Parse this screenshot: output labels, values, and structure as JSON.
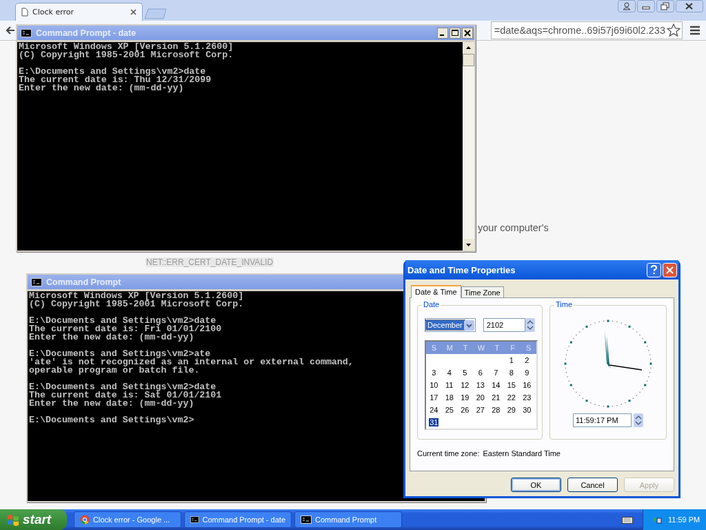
{
  "browser": {
    "tabs": [
      {
        "title": "Clock error",
        "selected": true
      }
    ],
    "address": "=date&aqs=chrome..69i57j69i60l2.233",
    "page_texts": [
      {
        "text": "your computer's",
        "kind": "body"
      },
      {
        "text": "NET::ERR_CERT_DATE_INVALID",
        "kind": "code"
      }
    ]
  },
  "console_windows": [
    {
      "title": "Command Prompt - date",
      "controls": true,
      "blocks": [
        [
          "Microsoft Windows XP [Version 5.1.2600]",
          "(C) Copyright 1985-2001 Microsoft Corp."
        ],
        [
          "E:\\Documents and Settings\\vm2>date",
          "The current date is: Thu 12/31/2099",
          "Enter the new date: (mm-dd-yy)"
        ]
      ]
    },
    {
      "title": "Command Prompt",
      "controls": false,
      "blocks": [
        [
          "Microsoft Windows XP [Version 5.1.2600]",
          "(C) Copyright 1985-2001 Microsoft Corp."
        ],
        [
          "E:\\Documents and Settings\\vm2>date",
          "The current date is: Fri 01/01/2100",
          "Enter the new date: (mm-dd-yy)"
        ],
        [
          "E:\\Documents and Settings\\vm2>ate",
          "'ate' is not recognized as an internal or external command,",
          "operable program or batch file."
        ],
        [
          "E:\\Documents and Settings\\vm2>date",
          "The current date is: Sat 01/01/2101",
          "Enter the new date: (mm-dd-yy)"
        ],
        [
          "E:\\Documents and Settings\\vm2>"
        ]
      ]
    }
  ],
  "dialog": {
    "title": "Date and Time Properties",
    "tabs": [
      {
        "label": "Date & Time",
        "selected": true
      },
      {
        "label": "Time Zone",
        "selected": false
      }
    ],
    "date_group": {
      "label": "Date",
      "month": "December",
      "year": "2102",
      "weekdays": [
        "S",
        "M",
        "T",
        "W",
        "T",
        "F",
        "S"
      ],
      "weeks": [
        [
          {
            "kind": "blank"
          },
          {
            "kind": "blank"
          },
          {
            "kind": "blank"
          },
          {
            "kind": "blank"
          },
          {
            "kind": "blank"
          },
          {
            "day": "1",
            "selected": false
          },
          {
            "day": "2",
            "selected": false
          }
        ],
        [
          {
            "day": "3",
            "selected": false
          },
          {
            "day": "4",
            "selected": false
          },
          {
            "day": "5",
            "selected": false
          },
          {
            "day": "6",
            "selected": false
          },
          {
            "day": "7",
            "selected": false
          },
          {
            "day": "8",
            "selected": false
          },
          {
            "day": "9",
            "selected": false
          }
        ],
        [
          {
            "day": "10",
            "selected": false
          },
          {
            "day": "11",
            "selected": false
          },
          {
            "day": "12",
            "selected": false
          },
          {
            "day": "13",
            "selected": false
          },
          {
            "day": "14",
            "selected": false
          },
          {
            "day": "15",
            "selected": false
          },
          {
            "day": "16",
            "selected": false
          }
        ],
        [
          {
            "day": "17",
            "selected": false
          },
          {
            "day": "18",
            "selected": false
          },
          {
            "day": "19",
            "selected": false
          },
          {
            "day": "20",
            "selected": false
          },
          {
            "day": "21",
            "selected": false
          },
          {
            "day": "22",
            "selected": false
          },
          {
            "day": "23",
            "selected": false
          }
        ],
        [
          {
            "day": "24",
            "selected": false
          },
          {
            "day": "25",
            "selected": false
          },
          {
            "day": "26",
            "selected": false
          },
          {
            "day": "27",
            "selected": false
          },
          {
            "day": "28",
            "selected": false
          },
          {
            "day": "29",
            "selected": false
          },
          {
            "day": "30",
            "selected": false
          }
        ],
        [
          {
            "day": "31",
            "selected": true
          }
        ]
      ]
    },
    "time_group": {
      "label": "Time",
      "time": "11:59:17 PM"
    },
    "timezone_label": "Current time zone:",
    "timezone": "Eastern Standard Time",
    "buttons": [
      {
        "label": "OK",
        "default": true,
        "disabled": false
      },
      {
        "label": "Cancel",
        "default": false,
        "disabled": false
      },
      {
        "label": "Apply",
        "default": false,
        "disabled": true
      }
    ]
  },
  "taskbar": {
    "start": "start",
    "tasks": [
      {
        "label": "Clock error - Google ...",
        "kind": "browser"
      },
      {
        "label": "Command Prompt - date",
        "kind": "console"
      },
      {
        "label": "Command Prompt",
        "kind": "console"
      }
    ],
    "clock": "11:59 PM"
  }
}
